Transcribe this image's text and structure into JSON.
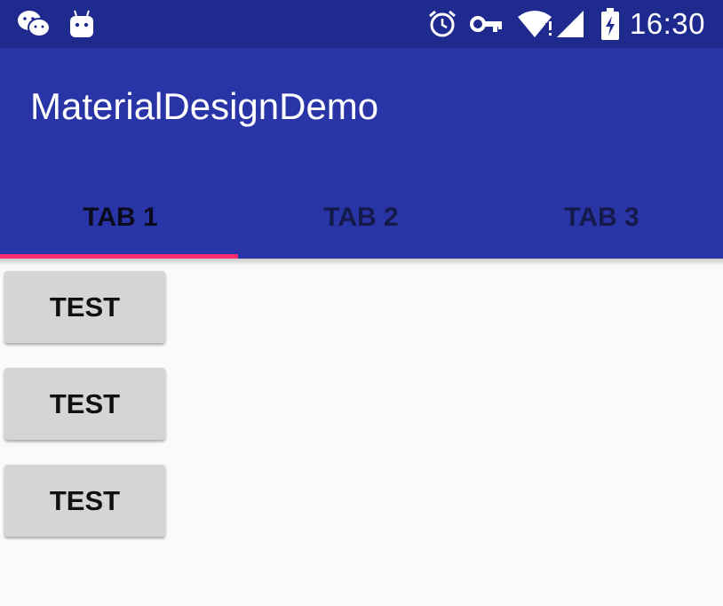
{
  "status_bar": {
    "time": "16:30",
    "icons": [
      "wechat-icon",
      "android-icon",
      "alarm-icon",
      "vpn-key-icon",
      "wifi-icon",
      "signal-icon",
      "battery-charging-icon"
    ]
  },
  "app_bar": {
    "title": "MaterialDesignDemo",
    "tabs": [
      {
        "label": "TAB 1",
        "selected": true
      },
      {
        "label": "TAB 2",
        "selected": false
      },
      {
        "label": "TAB 3",
        "selected": false
      }
    ]
  },
  "content": {
    "buttons": [
      {
        "label": "TEST"
      },
      {
        "label": "TEST"
      },
      {
        "label": "TEST"
      }
    ]
  },
  "colors": {
    "status_bar": "#1f2a8f",
    "primary": "#2935a6",
    "accent": "#ff2c6d",
    "background": "#fafafa",
    "button": "#d4d5d4"
  }
}
